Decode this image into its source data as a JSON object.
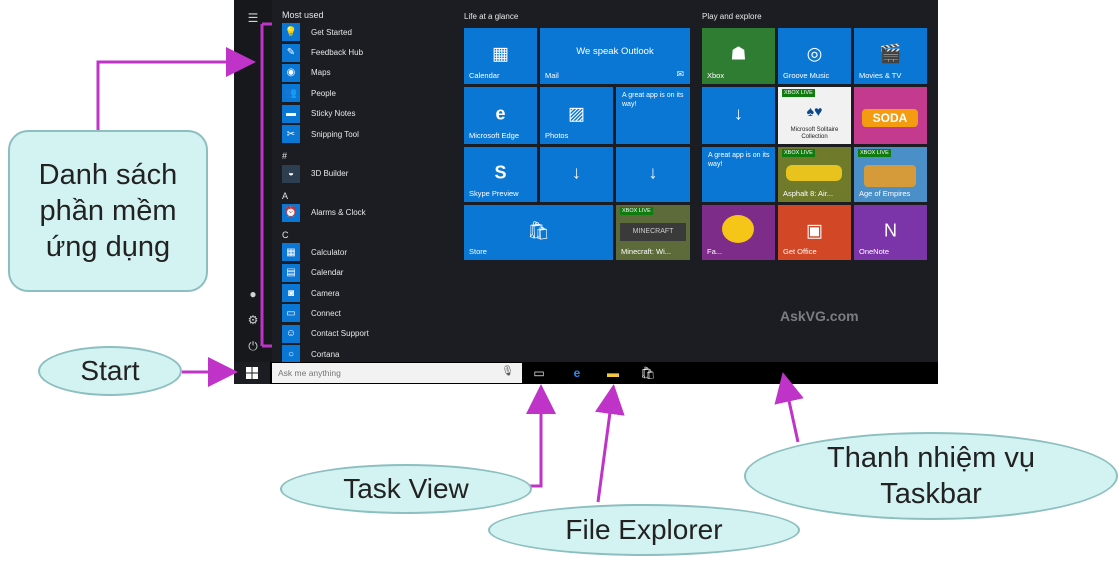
{
  "startmenu": {
    "most_used_label": "Most used",
    "apps_most": [
      "Get Started",
      "Feedback Hub",
      "Maps",
      "People",
      "Sticky Notes",
      "Snipping Tool"
    ],
    "hash_label": "#",
    "apps_hash": [
      "3D Builder"
    ],
    "a_label": "A",
    "apps_a": [
      "Alarms & Clock"
    ],
    "c_label": "C",
    "apps_c": [
      "Calculator",
      "Calendar",
      "Camera",
      "Connect",
      "Contact Support",
      "Cortana"
    ]
  },
  "tiles": {
    "group1_title": "Life at a glance",
    "group2_title": "Play and explore",
    "calendar": "Calendar",
    "mail": "Mail",
    "mail_big": "We speak Outlook",
    "edge": "Microsoft Edge",
    "photos": "Photos",
    "skype": "Skype Preview",
    "store": "Store",
    "note_text": "A great app is on its way!",
    "minecraft": "Minecraft: Wi...",
    "xbox": "Xbox",
    "groove": "Groove Music",
    "movies": "Movies & TV",
    "solitaire": "Microsoft Solitaire Collection",
    "asphalt": "Asphalt 8: Air...",
    "age": "Age of Empires",
    "fb": "Fa...",
    "getoffice": "Get Office",
    "onenote": "OneNote",
    "xbox_live": "XBOX LIVE",
    "soda": "SODA"
  },
  "taskbar": {
    "search_placeholder": "Ask me anything"
  },
  "watermark": "AskVG.com",
  "callouts": {
    "apps_list": "Danh sách phần mềm ứng dụng",
    "start": "Start",
    "task_view": "Task View",
    "file_explorer": "File Explorer",
    "taskbar_line1": "Thanh nhiệm vụ",
    "taskbar_line2": "Taskbar"
  },
  "colors": {
    "tile_blue": "#0a77d4",
    "arrow": "#c033c9",
    "bubble": "#d3f2f2"
  }
}
